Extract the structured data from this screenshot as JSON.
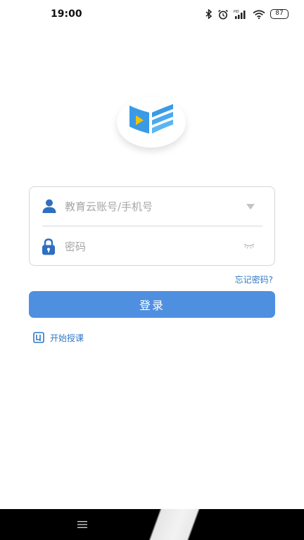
{
  "status_bar": {
    "time": "19:00",
    "battery": "87",
    "icons": [
      "bluetooth-icon",
      "alarm-icon",
      "hd-signal-icon",
      "wifi-icon",
      "battery-icon"
    ]
  },
  "logo": {
    "icon": "book-play-logo-icon"
  },
  "login_form": {
    "account_placeholder": "教育云账号/手机号",
    "password_placeholder": "密码",
    "account_icon": "user-icon",
    "password_icon": "lock-icon",
    "dropdown_icon": "triangle-down-icon",
    "visibility_icon": "closed-eye-icon"
  },
  "forgot_password": "忘记密码?",
  "login_button": "登录",
  "start_teaching": "开始授课",
  "colors": {
    "accent": "#4f8fe0",
    "link": "#2f78c6",
    "border": "#d6d6d6",
    "placeholder": "#a6a6a6",
    "logo_blue": "#3a9ae6",
    "logo_play": "#f5c400"
  },
  "nav_bar": {
    "menu_icon": "menu-icon"
  }
}
